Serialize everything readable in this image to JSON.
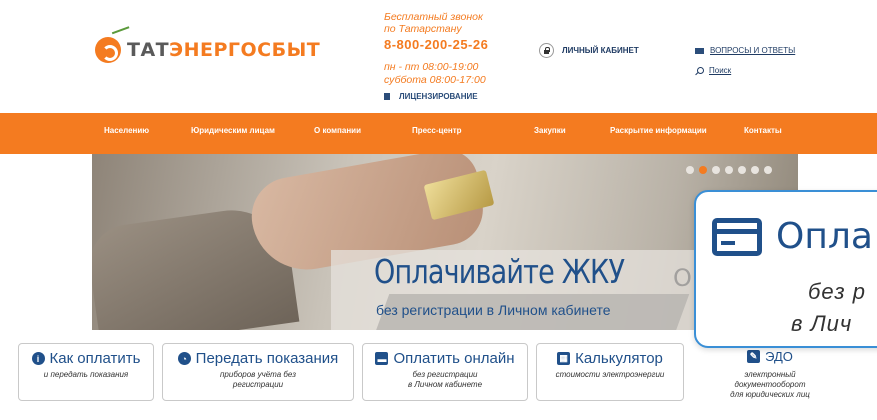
{
  "brand": {
    "logo_part1": "ТАТ",
    "logo_part2": "ЭНЕРГОСБЫТ"
  },
  "contact": {
    "free_call": "Бесплатный звонок",
    "region": "по Татарстану",
    "phone": "8-800-200-25-26",
    "hours_weekdays": "пн - пт  08:00-19:00",
    "hours_saturday": "суббота 08:00-17:00",
    "licensing": "ЛИЦЕНЗИРОВАНИЕ"
  },
  "header_links": {
    "cabinet": "ЛИЧНЫЙ КАБИНЕТ",
    "faq": "ВОПРОСЫ И ОТВЕТЫ",
    "search": "Поиск"
  },
  "nav": {
    "items": [
      "Населению",
      "Юридическим лицам",
      "О компании",
      "Пресс-центр",
      "Закупки",
      "Раскрытие информации",
      "Контакты"
    ]
  },
  "banner": {
    "title": "Оплачивайте ЖКУ",
    "title_ghost": "ОН",
    "subtitle": "без регистрации в Личном кабинете",
    "slides_total": 7,
    "active_slide": 2
  },
  "zoom": {
    "title": "Опла",
    "line1": "без р",
    "line2": "в Лич"
  },
  "quick": [
    {
      "icon": "info-icon",
      "glyph": "i",
      "title": "Как оплатить",
      "sub1": "и передать показания",
      "sub2": "",
      "sub3": ""
    },
    {
      "icon": "gauge-icon",
      "glyph": "◔",
      "title": "Передать показания",
      "sub1": "приборов учёта без",
      "sub2": "регистрации",
      "sub3": ""
    },
    {
      "icon": "credit-card-icon",
      "glyph": "▬",
      "title": "Оплатить онлайн",
      "sub1": "без регистрации",
      "sub2": "в Личном кабинете",
      "sub3": ""
    },
    {
      "icon": "calculator-icon",
      "glyph": "▦",
      "title": "Калькулятор",
      "sub1": "стоимости электроэнергии",
      "sub2": "",
      "sub3": ""
    },
    {
      "icon": "edit-icon",
      "glyph": "✎",
      "title": "ЭДО",
      "sub1": "электронный",
      "sub2": "документооборот",
      "sub3": "для юридических лиц"
    }
  ],
  "colors": {
    "accent": "#f47b20",
    "brand_blue": "#20508a",
    "zoom_border": "#3a8fd6"
  }
}
